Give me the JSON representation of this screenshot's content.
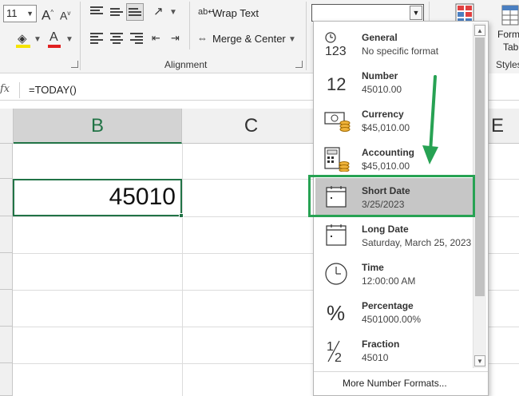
{
  "ribbon": {
    "font_size": "11",
    "font_grow": "A",
    "font_shrink": "A",
    "wrap_text": "Wrap Text",
    "merge_center": "Merge & Center",
    "alignment_label": "Alignment",
    "format_label": "Form",
    "table_label": "Tabl",
    "styles_label": "Styles"
  },
  "formula_bar": {
    "fx": "fx",
    "formula": "=TODAY()"
  },
  "grid": {
    "columns": [
      "B",
      "C",
      "E"
    ],
    "active_cell_value": "45010"
  },
  "number_formats": {
    "items": [
      {
        "name": "General",
        "example": "No specific format",
        "icon": "general-123-icon"
      },
      {
        "name": "Number",
        "example": "45010.00",
        "icon": "number-12-icon"
      },
      {
        "name": "Currency",
        "example": "$45,010.00",
        "icon": "currency-icon"
      },
      {
        "name": "Accounting",
        "example": " $45,010.00",
        "icon": "accounting-icon"
      },
      {
        "name": "Short Date",
        "example": "3/25/2023",
        "icon": "calendar-icon"
      },
      {
        "name": "Long Date",
        "example": "Saturday, March 25, 2023",
        "icon": "calendar-icon"
      },
      {
        "name": "Time",
        "example": "12:00:00 AM",
        "icon": "clock-icon"
      },
      {
        "name": "Percentage",
        "example": "4501000.00%",
        "icon": "percent-icon"
      },
      {
        "name": "Fraction",
        "example": "45010",
        "icon": "fraction-icon"
      }
    ],
    "selected": "Short Date",
    "more": "More Number Formats..."
  },
  "colors": {
    "excel_green": "#217346",
    "highlight_green": "#27a253",
    "font_color_red": "#e02020",
    "fill_yellow": "#f5e400"
  }
}
